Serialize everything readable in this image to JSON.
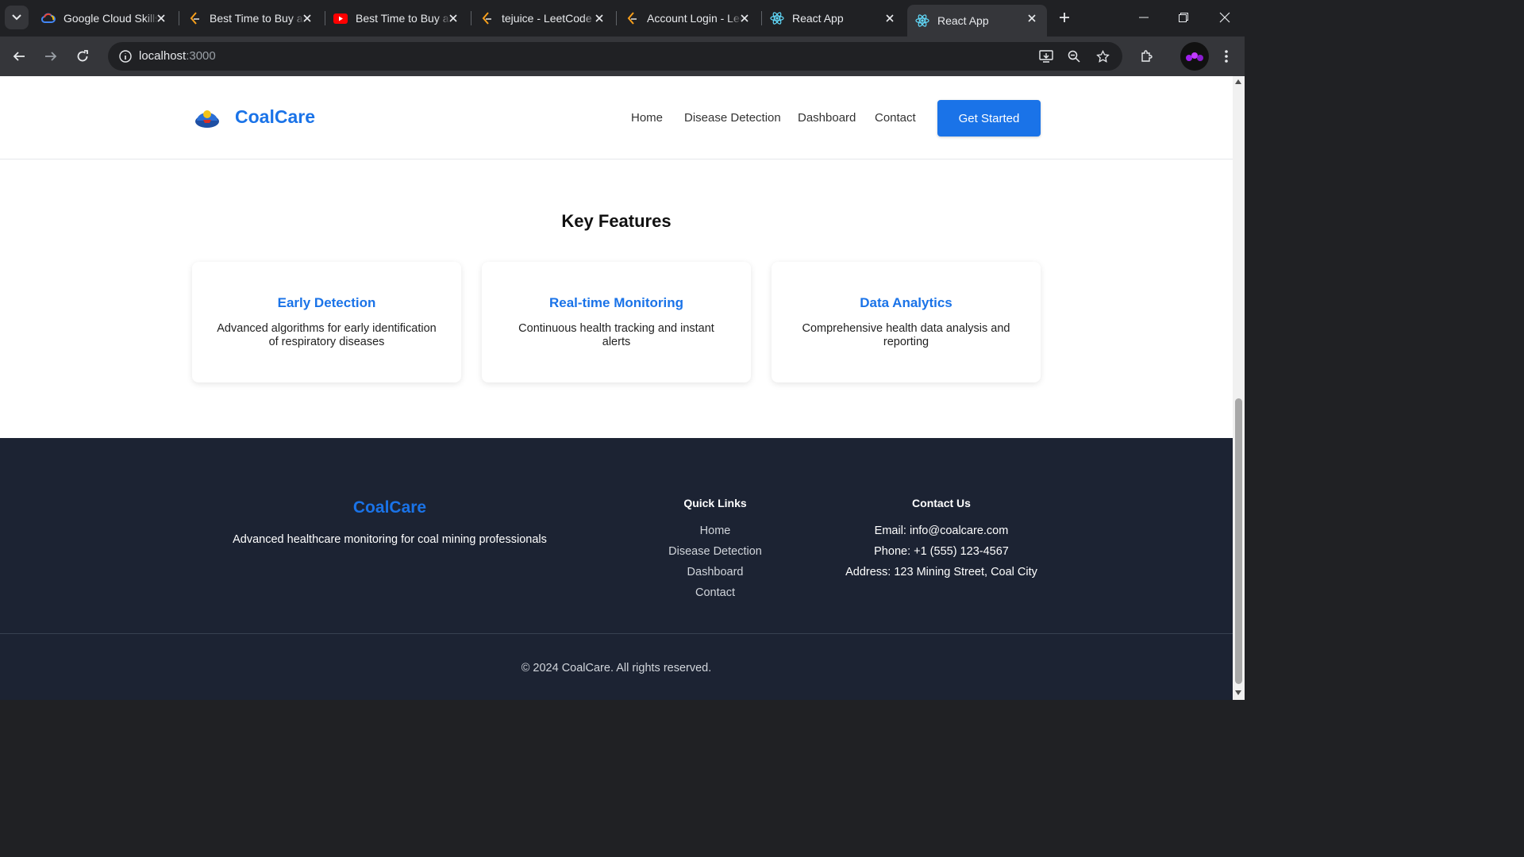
{
  "browser": {
    "tabs": [
      {
        "title": "Google Cloud Skills Boost",
        "icon": "google-cloud-icon"
      },
      {
        "title": "Best Time to Buy and Sell",
        "icon": "leetcode-icon"
      },
      {
        "title": "Best Time to Buy and Sell",
        "icon": "youtube-icon"
      },
      {
        "title": "tejuice - LeetCode",
        "icon": "leetcode-icon"
      },
      {
        "title": "Account Login - LeetCode",
        "icon": "leetcode-icon"
      },
      {
        "title": "React App",
        "icon": "react-icon"
      },
      {
        "title": "React App",
        "icon": "react-icon",
        "active": true
      }
    ],
    "url_host": "localhost",
    "url_port": ":3000"
  },
  "site": {
    "brand": "CoalCare",
    "nav": [
      "Home",
      "Disease Detection",
      "Dashboard",
      "Contact"
    ],
    "cta": "Get Started",
    "features_title": "Key Features",
    "features": [
      {
        "title": "Early Detection",
        "desc": "Advanced algorithms for early identification of respiratory diseases"
      },
      {
        "title": "Real-time Monitoring",
        "desc": "Continuous health tracking and instant alerts"
      },
      {
        "title": "Data Analytics",
        "desc": "Comprehensive health data analysis and reporting"
      }
    ],
    "footer": {
      "brand": "CoalCare",
      "tagline": "Advanced healthcare monitoring for coal mining professionals",
      "quick_links_title": "Quick Links",
      "quick_links": [
        "Home",
        "Disease Detection",
        "Dashboard",
        "Contact"
      ],
      "contact_title": "Contact Us",
      "email": "Email: info@coalcare.com",
      "phone": "Phone: +1 (555) 123-4567",
      "address": "Address: 123 Mining Street, Coal City",
      "copyright": "© 2024 CoalCare. All rights reserved."
    }
  },
  "colors": {
    "accent": "#1a73e8",
    "footer_bg": "#1c2333"
  }
}
